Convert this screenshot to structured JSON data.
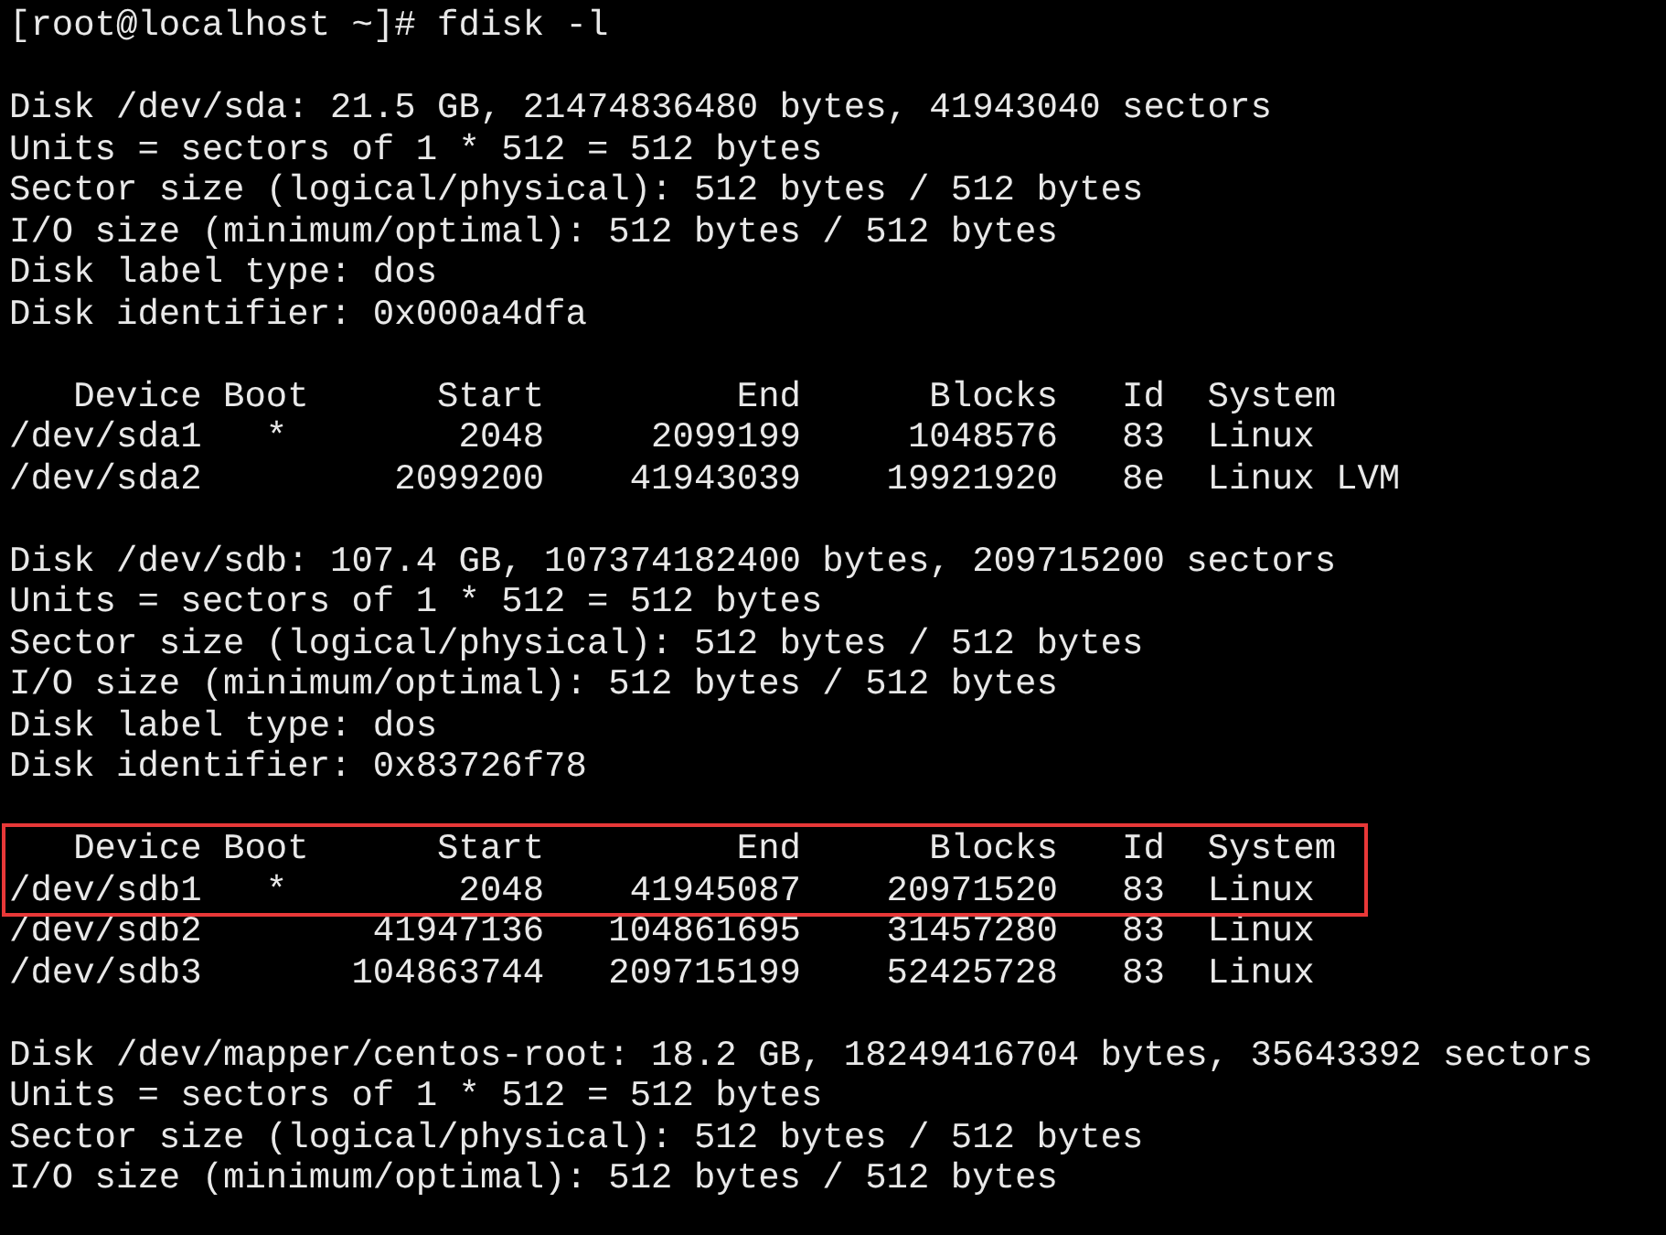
{
  "prompt": "[root@localhost ~]# fdisk -l",
  "disks": [
    {
      "info": [
        "Disk /dev/sda: 21.5 GB, 21474836480 bytes, 41943040 sectors",
        "Units = sectors of 1 * 512 = 512 bytes",
        "Sector size (logical/physical): 512 bytes / 512 bytes",
        "I/O size (minimum/optimal): 512 bytes / 512 bytes",
        "Disk label type: dos",
        "Disk identifier: 0x000a4dfa"
      ],
      "table": [
        {
          "text": "   Device Boot      Start         End      Blocks   Id  System",
          "highlighted": false
        },
        {
          "text": "/dev/sda1   *        2048     2099199     1048576   83  Linux",
          "highlighted": false
        },
        {
          "text": "/dev/sda2         2099200    41943039    19921920   8e  Linux LVM",
          "highlighted": false
        }
      ]
    },
    {
      "info": [
        "Disk /dev/sdb: 107.4 GB, 107374182400 bytes, 209715200 sectors",
        "Units = sectors of 1 * 512 = 512 bytes",
        "Sector size (logical/physical): 512 bytes / 512 bytes",
        "I/O size (minimum/optimal): 512 bytes / 512 bytes",
        "Disk label type: dos",
        "Disk identifier: 0x83726f78"
      ],
      "table": [
        {
          "text": "   Device Boot      Start         End      Blocks   Id  System",
          "highlighted": true
        },
        {
          "text": "/dev/sdb1   *        2048    41945087    20971520   83  Linux",
          "highlighted": true
        },
        {
          "text": "/dev/sdb2        41947136   104861695    31457280   83  Linux",
          "highlighted": false
        },
        {
          "text": "/dev/sdb3       104863744   209715199    52425728   83  Linux",
          "highlighted": false
        }
      ]
    },
    {
      "info": [
        "Disk /dev/mapper/centos-root: 18.2 GB, 18249416704 bytes, 35643392 sectors",
        "Units = sectors of 1 * 512 = 512 bytes",
        "Sector size (logical/physical): 512 bytes / 512 bytes",
        "I/O size (minimum/optimal): 512 bytes / 512 bytes"
      ]
    }
  ]
}
